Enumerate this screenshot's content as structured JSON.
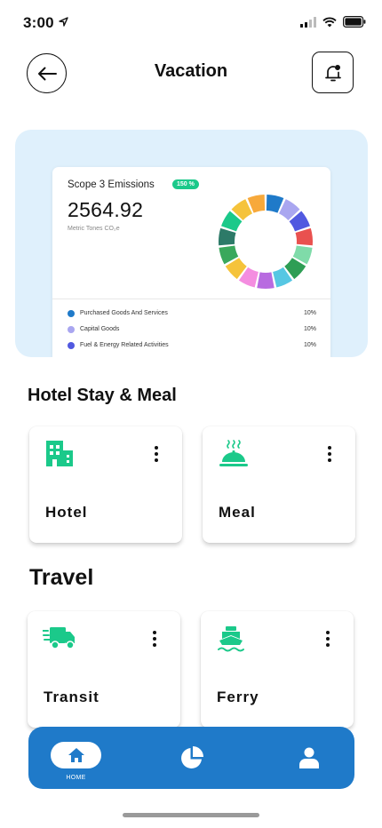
{
  "status_bar": {
    "time": "3:00"
  },
  "header": {
    "title": "Vacation"
  },
  "emissions_card": {
    "title": "Scope 3 Emissions",
    "badge": "150 %",
    "value": "2564.92",
    "unit": "Metric Tones CO₂e",
    "legend": [
      {
        "label": "Purchased Goods And Services",
        "percent": "10%",
        "color": "#1f7ac9"
      },
      {
        "label": "Capital Goods",
        "percent": "10%",
        "color": "#a9a6f0"
      },
      {
        "label": "Fuel & Energy Related Activities",
        "percent": "10%",
        "color": "#5159e0"
      }
    ],
    "donut_colors": [
      "#1f7ac9",
      "#a9a6f0",
      "#5159e0",
      "#e9514f",
      "#7fdba9",
      "#2e9e55",
      "#56c7e3",
      "#b86be0",
      "#f48de0",
      "#f5c33b",
      "#3aa85c",
      "#2d7a68",
      "#1bc98a",
      "#f5c33b",
      "#f7a93b"
    ]
  },
  "sections": {
    "hotel": {
      "title": "Hotel Stay & Meal",
      "tiles": [
        {
          "label": "Hotel",
          "icon": "building-icon"
        },
        {
          "label": "Meal",
          "icon": "food-tray-icon"
        }
      ]
    },
    "travel": {
      "title": "Travel",
      "tiles": [
        {
          "label": "Transit",
          "icon": "truck-icon"
        },
        {
          "label": "Ferry",
          "icon": "ship-icon"
        }
      ]
    }
  },
  "bottom_nav": {
    "home_label": "HOME",
    "items": [
      "home-icon",
      "pie-chart-icon",
      "profile-icon"
    ]
  },
  "colors": {
    "accent": "#1bc98a",
    "nav": "#1f7ac9",
    "hero_bg": "#dff0fc"
  }
}
